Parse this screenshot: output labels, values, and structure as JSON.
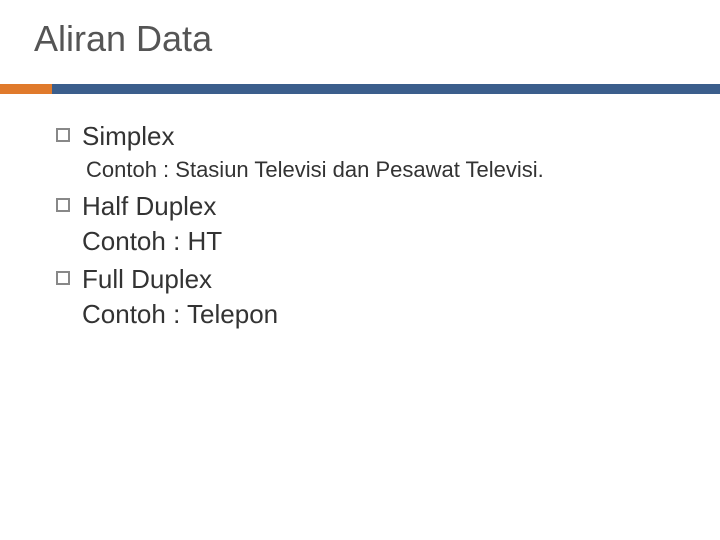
{
  "title": "Aliran Data",
  "items": [
    {
      "heading": "Simplex",
      "example": "Contoh : Stasiun Televisi dan Pesawat Televisi."
    },
    {
      "heading": "Half Duplex",
      "example": "Contoh : HT"
    },
    {
      "heading": "Full Duplex",
      "example": "Contoh : Telepon"
    }
  ]
}
